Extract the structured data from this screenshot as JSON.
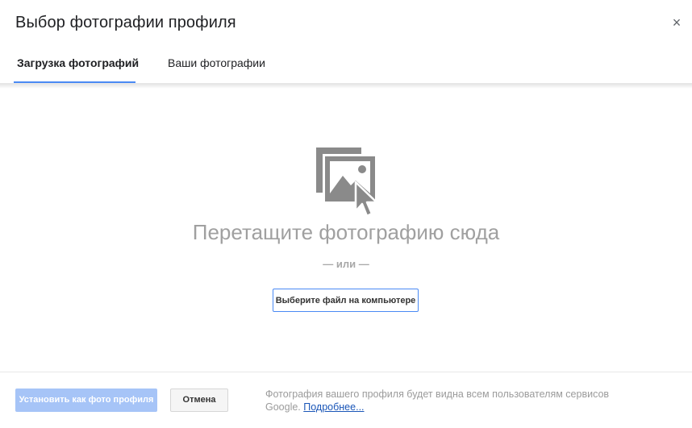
{
  "dialog": {
    "title": "Выбор фотографии профиля",
    "close_label": "×"
  },
  "tabs": [
    {
      "label": "Загрузка фотографий",
      "active": true
    },
    {
      "label": "Ваши фотографии",
      "active": false
    }
  ],
  "upload": {
    "icon": "photo-drag-icon",
    "drop_text": "Перетащите фотографию сюда",
    "or_text": "— или —",
    "choose_button": "Выберите файл на компьютере"
  },
  "footer": {
    "set_button": "Установить как фото профиля",
    "cancel_button": "Отмена",
    "note": "Фотография вашего профиля будет видна всем пользователям сервисов Google.",
    "link": "Подробнее..."
  },
  "colors": {
    "accent": "#4a8af4",
    "disabled_button": "#a6c4f7",
    "icon_gray": "#8a8a8a",
    "muted_text": "#a0a0a0"
  }
}
